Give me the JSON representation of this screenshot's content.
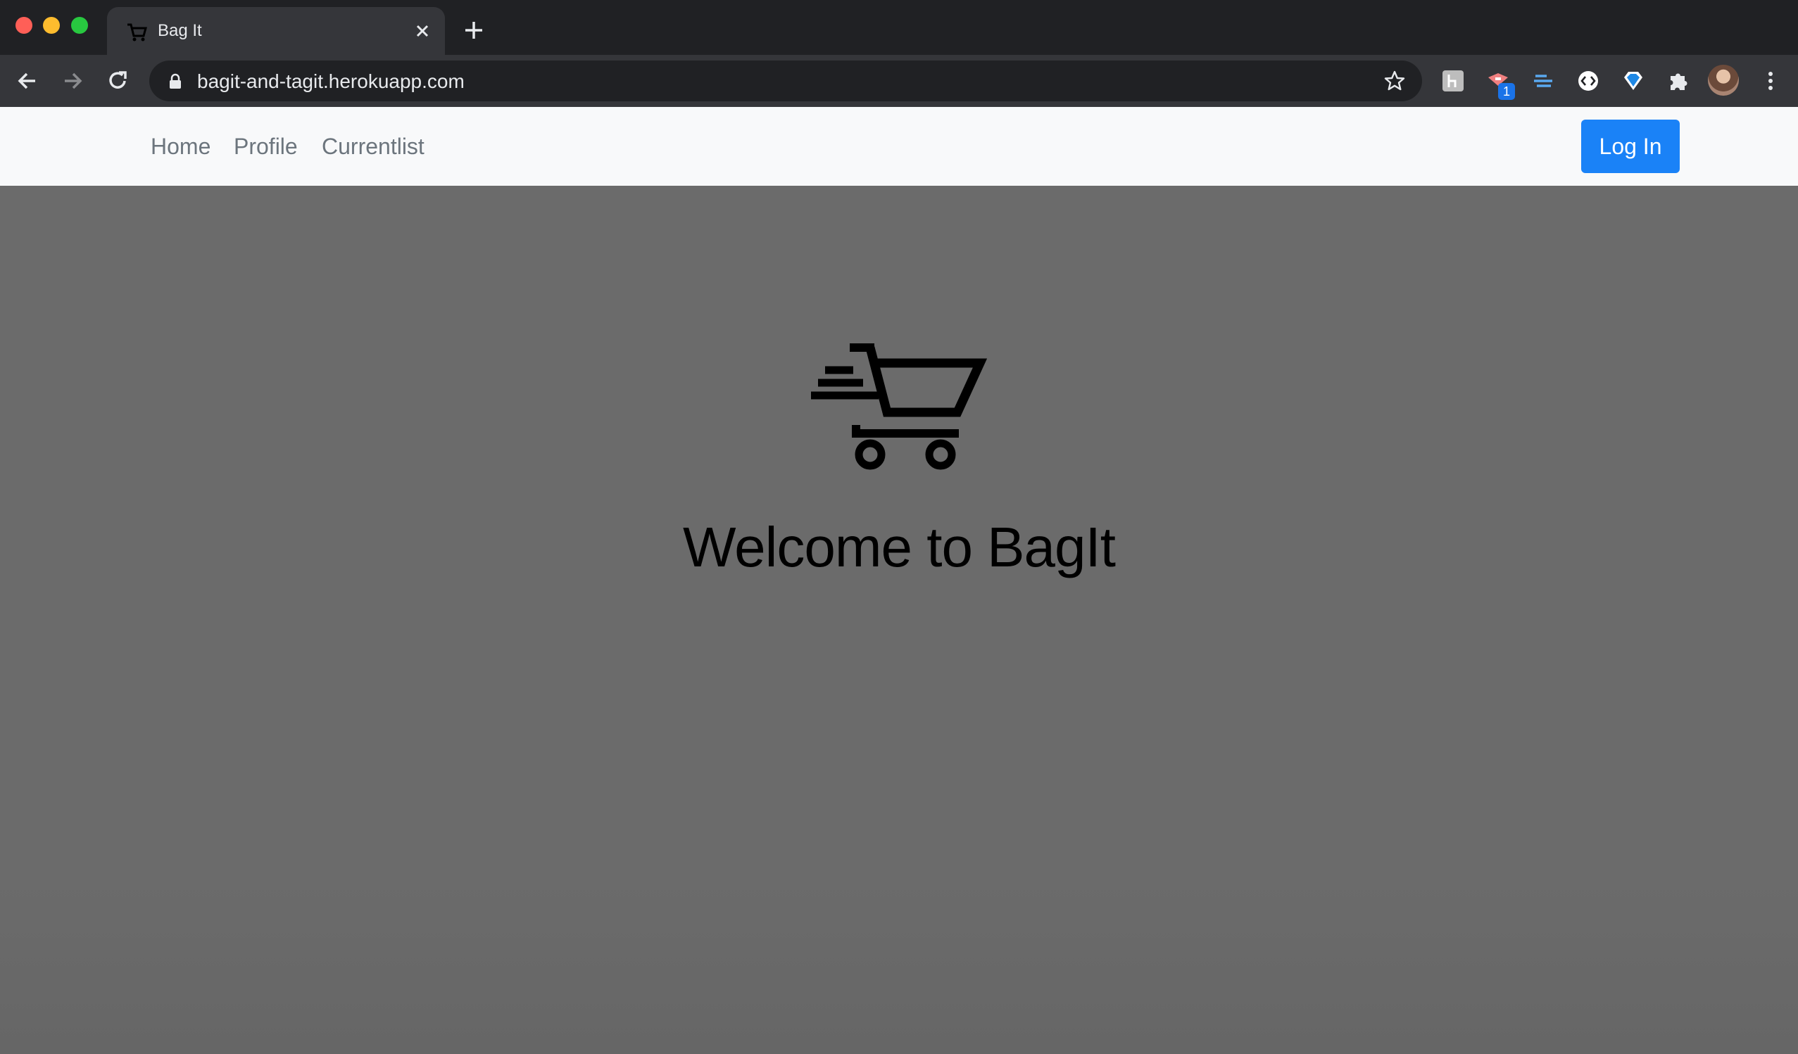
{
  "browser": {
    "tab_title": "Bag It",
    "url": "bagit-and-tagit.herokuapp.com",
    "extension_badge": "1"
  },
  "navbar": {
    "links": [
      "Home",
      "Profile",
      "Currentlist"
    ],
    "login_label": "Log In"
  },
  "hero": {
    "title": "Welcome to BagIt",
    "icon": "shopping-cart-speed-icon"
  },
  "colors": {
    "navbar_bg": "#f8f9fa",
    "overlay_bg": "#6b6b6b",
    "login_button": "#1a82f7",
    "nav_link": "#6c757d"
  }
}
